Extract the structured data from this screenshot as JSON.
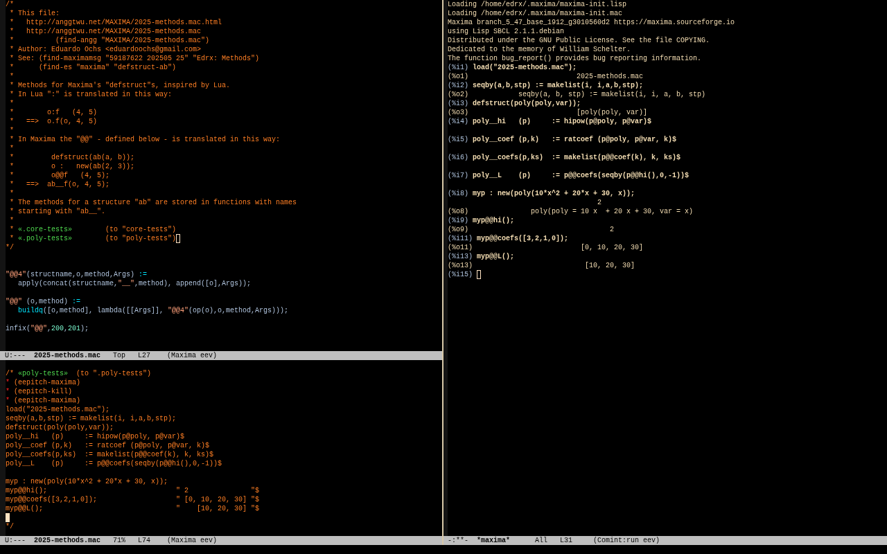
{
  "windows": [
    {
      "lines": [
        {
          "kind": "text",
          "segments": [
            {
              "text": "/*",
              "kind": "comment"
            }
          ]
        },
        {
          "kind": "text",
          "segments": [
            {
              "text": " * This file:",
              "kind": "comment"
            }
          ]
        },
        {
          "kind": "text",
          "segments": [
            {
              "text": " *   http://anggtwu.net/MAXIMA/2025-methods.mac.html",
              "kind": "comment"
            }
          ]
        },
        {
          "kind": "text",
          "segments": [
            {
              "text": " *   http://anggtwu.net/MAXIMA/2025-methods.mac",
              "kind": "comment"
            }
          ]
        },
        {
          "kind": "text",
          "segments": [
            {
              "text": " *          (find-angg \"MAXIMA/2025-methods.mac\")",
              "kind": "comment"
            }
          ]
        },
        {
          "kind": "text",
          "segments": [
            {
              "text": " * Author: Eduardo Ochs <eduardoochs@gmail.com>",
              "kind": "comment"
            }
          ]
        },
        {
          "kind": "text",
          "segments": [
            {
              "text": " * See: (find-maximamsg \"59187622 202505 25\" \"Edrx: Methods\")",
              "kind": "comment"
            }
          ]
        },
        {
          "kind": "text",
          "segments": [
            {
              "text": " *      (find-es \"maxima\" \"defstruct-ab\")",
              "kind": "comment"
            }
          ]
        },
        {
          "kind": "text",
          "segments": [
            {
              "text": " *",
              "kind": "comment"
            }
          ]
        },
        {
          "kind": "text",
          "segments": [
            {
              "text": " * Methods for Maxima's \"defstruct\"s, inspired by Lua.",
              "kind": "comment"
            }
          ]
        },
        {
          "kind": "text",
          "segments": [
            {
              "text": " * In Lua \":\" is translated in this way:",
              "kind": "comment"
            }
          ]
        },
        {
          "kind": "text",
          "segments": [
            {
              "text": " *",
              "kind": "comment"
            }
          ]
        },
        {
          "kind": "text",
          "segments": [
            {
              "text": " *        o:f   (4, 5)",
              "kind": "comment"
            }
          ]
        },
        {
          "kind": "text",
          "segments": [
            {
              "text": " *   ==>  o.f(o, 4, 5)",
              "kind": "comment"
            }
          ]
        },
        {
          "kind": "text",
          "segments": [
            {
              "text": " *",
              "kind": "comment"
            }
          ]
        },
        {
          "kind": "text",
          "segments": [
            {
              "text": " * In Maxima the \"@@\" - defined below - is translated in this way:",
              "kind": "comment"
            }
          ]
        },
        {
          "kind": "text",
          "segments": [
            {
              "text": " *",
              "kind": "comment"
            }
          ]
        },
        {
          "kind": "text",
          "segments": [
            {
              "text": " *         defstruct(ab(a, b));",
              "kind": "comment"
            }
          ]
        },
        {
          "kind": "text",
          "segments": [
            {
              "text": " *         o :   new(ab(2, 3));",
              "kind": "comment"
            }
          ]
        },
        {
          "kind": "text",
          "segments": [
            {
              "text": " *         o@@f   (4, 5);",
              "kind": "comment"
            }
          ]
        },
        {
          "kind": "text",
          "segments": [
            {
              "text": " *   ==>  ab__f(o, 4, 5);",
              "kind": "comment"
            }
          ]
        },
        {
          "kind": "text",
          "segments": [
            {
              "text": " *",
              "kind": "comment"
            }
          ]
        },
        {
          "kind": "text",
          "segments": [
            {
              "text": " * The methods for a structure \"ab\" are stored in functions with names",
              "kind": "comment"
            }
          ]
        },
        {
          "kind": "text",
          "segments": [
            {
              "text": " * starting with \"ab__\".",
              "kind": "comment"
            }
          ]
        },
        {
          "kind": "text",
          "segments": [
            {
              "text": " *",
              "kind": "comment"
            }
          ]
        },
        {
          "kind": "text",
          "segments": [
            {
              "text": " * ",
              "kind": "comment"
            },
            {
              "text": "«.core-tests»",
              "kind": "anchor"
            },
            {
              "text": "        (to \"core-tests\")",
              "kind": "comment"
            }
          ]
        },
        {
          "kind": "text",
          "segments": [
            {
              "text": " * ",
              "kind": "comment"
            },
            {
              "text": "«.poly-tests»",
              "kind": "anchor"
            },
            {
              "text": "        (to \"poly-tests\")",
              "kind": "comment"
            }
          ],
          "cursor": {
            "filled": false
          }
        },
        {
          "kind": "text",
          "segments": [
            {
              "text": "*/",
              "kind": "comment"
            }
          ]
        },
        {
          "kind": "blank"
        },
        {
          "kind": "blank"
        },
        {
          "kind": "text",
          "segments": [
            {
              "text": "\"@@4\"",
              "kind": "string"
            },
            {
              "text": "(structname,o,method,Args) ",
              "kind": "code"
            },
            {
              "text": ":=",
              "kind": "op"
            }
          ]
        },
        {
          "kind": "text",
          "segments": [
            {
              "text": "   apply(concat(structname,",
              "kind": "code"
            },
            {
              "text": "\"__\"",
              "kind": "string"
            },
            {
              "text": ",method), append([o],Args));",
              "kind": "code"
            }
          ]
        },
        {
          "kind": "blank"
        },
        {
          "kind": "text",
          "segments": [
            {
              "text": "\"@@\"",
              "kind": "string"
            },
            {
              "text": " (o,method) ",
              "kind": "code"
            },
            {
              "text": ":=",
              "kind": "op"
            }
          ]
        },
        {
          "kind": "text",
          "segments": [
            {
              "text": "   buildq",
              "kind": "op"
            },
            {
              "text": "([o,method], lambda([[Args]], ",
              "kind": "code"
            },
            {
              "text": "\"@@4\"",
              "kind": "string"
            },
            {
              "text": "(op(o),o,method,Args)));",
              "kind": "code"
            }
          ]
        },
        {
          "kind": "blank"
        },
        {
          "kind": "text",
          "segments": [
            {
              "text": "infix(",
              "kind": "code"
            },
            {
              "text": "\"@@\"",
              "kind": "string"
            },
            {
              "text": ",",
              "kind": "code"
            },
            {
              "text": "200",
              "kind": "number"
            },
            {
              "text": ",",
              "kind": "code"
            },
            {
              "text": "201",
              "kind": "number"
            },
            {
              "text": ");",
              "kind": "code"
            }
          ]
        }
      ],
      "mode_line": [
        {
          "text": "U:---  ",
          "bold": false
        },
        {
          "text": "2025-methods.mac",
          "bold": true
        },
        {
          "text": "   Top   L27    (Maxima eev)",
          "bold": false
        }
      ]
    },
    {
      "lines": [
        {
          "kind": "blank"
        },
        {
          "kind": "text",
          "segments": [
            {
              "text": "/* ",
              "kind": "comment"
            },
            {
              "text": "«poly-tests»",
              "kind": "anchor"
            },
            {
              "text": "  (to \".poly-tests\")",
              "kind": "comment"
            }
          ]
        },
        {
          "kind": "text",
          "segments": [
            {
              "text": "*",
              "kind": "star"
            },
            {
              "text": " (eepitch-maxima)",
              "kind": "comment"
            }
          ]
        },
        {
          "kind": "text",
          "segments": [
            {
              "text": "*",
              "kind": "star"
            },
            {
              "text": " (eepitch-kill)",
              "kind": "comment"
            }
          ]
        },
        {
          "kind": "text",
          "segments": [
            {
              "text": "*",
              "kind": "star"
            },
            {
              "text": " (eepitch-maxima)",
              "kind": "comment"
            }
          ]
        },
        {
          "kind": "text",
          "segments": [
            {
              "text": "load(\"2025-methods.mac\");",
              "kind": "comment"
            }
          ]
        },
        {
          "kind": "text",
          "segments": [
            {
              "text": "seqby(a,b,stp) := makelist(i, i,a,b,stp);",
              "kind": "comment"
            }
          ]
        },
        {
          "kind": "text",
          "segments": [
            {
              "text": "defstruct(poly(poly,var));",
              "kind": "comment"
            }
          ]
        },
        {
          "kind": "text",
          "segments": [
            {
              "text": "poly__hi   (p)     := hipow(p@poly, p@var)$",
              "kind": "comment"
            }
          ]
        },
        {
          "kind": "text",
          "segments": [
            {
              "text": "poly__coef (p,k)   := ratcoef (p@poly, p@var, k)$",
              "kind": "comment"
            }
          ]
        },
        {
          "kind": "text",
          "segments": [
            {
              "text": "poly__coefs(p,ks)  := makelist(p@@coef(k), k, ks)$",
              "kind": "comment"
            }
          ]
        },
        {
          "kind": "text",
          "segments": [
            {
              "text": "poly__L    (p)     := p@@coefs(seqby(p@@hi(),0,-1))$",
              "kind": "comment"
            }
          ]
        },
        {
          "kind": "blank"
        },
        {
          "kind": "text",
          "segments": [
            {
              "text": "myp : new(poly(10*x^2 + 20*x + 30, x));",
              "kind": "comment"
            }
          ]
        },
        {
          "kind": "text",
          "segments": [
            {
              "text": "myp@@hi();                               \" 2               \"$",
              "kind": "comment"
            }
          ]
        },
        {
          "kind": "text",
          "segments": [
            {
              "text": "myp@@coefs([3,2,1,0]);                   \" [0, 10, 20, 30] \"$",
              "kind": "comment"
            }
          ]
        },
        {
          "kind": "text",
          "segments": [
            {
              "text": "myp@@L();                                \"    [10, 20, 30] \"$",
              "kind": "comment"
            }
          ]
        },
        {
          "kind": "cursor",
          "cursor": {
            "filled": true
          }
        },
        {
          "kind": "text",
          "segments": [
            {
              "text": "*/",
              "kind": "comment"
            }
          ]
        }
      ],
      "mode_line": [
        {
          "text": "U:---  ",
          "bold": false
        },
        {
          "text": "2025-methods.mac",
          "bold": true
        },
        {
          "text": "   71%   L74    (Maxima eev)",
          "bold": false
        }
      ]
    },
    {
      "lines": [
        {
          "kind": "text",
          "segments": [
            {
              "text": "Loading /home/edrx/.maxima/maxima-init.lisp",
              "kind": "output"
            }
          ]
        },
        {
          "kind": "text",
          "segments": [
            {
              "text": "Loading /home/edrx/.maxima/maxima-init.mac",
              "kind": "output"
            }
          ]
        },
        {
          "kind": "text",
          "segments": [
            {
              "text": "Maxima branch_5_47_base_1912_g3010560d2 https://maxima.sourceforge.io",
              "kind": "output"
            }
          ]
        },
        {
          "kind": "text",
          "segments": [
            {
              "text": "using Lisp SBCL 2.1.1.debian",
              "kind": "output"
            }
          ]
        },
        {
          "kind": "text",
          "segments": [
            {
              "text": "Distributed under the GNU Public License. See the file COPYING.",
              "kind": "output"
            }
          ]
        },
        {
          "kind": "text",
          "segments": [
            {
              "text": "Dedicated to the memory of William Schelter.",
              "kind": "output"
            }
          ]
        },
        {
          "kind": "text",
          "segments": [
            {
              "text": "The function bug_report() provides bug reporting information.",
              "kind": "output"
            }
          ]
        },
        {
          "kind": "text",
          "segments": [
            {
              "text": "(%i1)",
              "kind": "prompt"
            },
            {
              "text": " load(\"2025-methods.mac\");",
              "kind": "input"
            }
          ]
        },
        {
          "kind": "text",
          "segments": [
            {
              "text": "(%o1)                          2025-methods.mac",
              "kind": "output"
            }
          ]
        },
        {
          "kind": "text",
          "segments": [
            {
              "text": "(%i2)",
              "kind": "prompt"
            },
            {
              "text": " seqby(a,b,stp) := makelist(i, i,a,b,stp);",
              "kind": "input"
            }
          ]
        },
        {
          "kind": "text",
          "segments": [
            {
              "text": "(%o2)            seqby(a, b, stp) := makelist(i, i, a, b, stp)",
              "kind": "output"
            }
          ]
        },
        {
          "kind": "text",
          "segments": [
            {
              "text": "(%i3)",
              "kind": "prompt"
            },
            {
              "text": " defstruct(poly(poly,var));",
              "kind": "input"
            }
          ]
        },
        {
          "kind": "text",
          "segments": [
            {
              "text": "(%o3)                          [poly(poly, var)]",
              "kind": "output"
            }
          ]
        },
        {
          "kind": "text",
          "segments": [
            {
              "text": "(%i4)",
              "kind": "prompt"
            },
            {
              "text": " poly__hi   (p)     := hipow(p@poly, p@var)$",
              "kind": "input"
            }
          ]
        },
        {
          "kind": "blank"
        },
        {
          "kind": "text",
          "segments": [
            {
              "text": "(%i5)",
              "kind": "prompt"
            },
            {
              "text": " poly__coef (p,k)   := ratcoef (p@poly, p@var, k)$",
              "kind": "input"
            }
          ]
        },
        {
          "kind": "blank"
        },
        {
          "kind": "text",
          "segments": [
            {
              "text": "(%i6)",
              "kind": "prompt"
            },
            {
              "text": " poly__coefs(p,ks)  := makelist(p@@coef(k), k, ks)$",
              "kind": "input"
            }
          ]
        },
        {
          "kind": "blank"
        },
        {
          "kind": "text",
          "segments": [
            {
              "text": "(%i7)",
              "kind": "prompt"
            },
            {
              "text": " poly__L    (p)     := p@@coefs(seqby(p@@hi(),0,-1))$",
              "kind": "input"
            }
          ]
        },
        {
          "kind": "blank"
        },
        {
          "kind": "text",
          "segments": [
            {
              "text": "(%i8)",
              "kind": "prompt"
            },
            {
              "text": " myp : new(poly(10*x^2 + 20*x + 30, x));",
              "kind": "input"
            }
          ]
        },
        {
          "kind": "text",
          "segments": [
            {
              "text": "                                    2",
              "kind": "output"
            }
          ]
        },
        {
          "kind": "text",
          "segments": [
            {
              "text": "(%o8)               poly(poly = 10 x  + 20 x + 30, var = x)",
              "kind": "output"
            }
          ]
        },
        {
          "kind": "text",
          "segments": [
            {
              "text": "(%i9)",
              "kind": "prompt"
            },
            {
              "text": " myp@@hi();",
              "kind": "input"
            }
          ]
        },
        {
          "kind": "text",
          "segments": [
            {
              "text": "(%o9)                                  2",
              "kind": "output"
            }
          ]
        },
        {
          "kind": "text",
          "segments": [
            {
              "text": "(%i11)",
              "kind": "prompt"
            },
            {
              "text": " myp@@coefs([3,2,1,0]);",
              "kind": "input"
            }
          ]
        },
        {
          "kind": "text",
          "segments": [
            {
              "text": "(%o11)                          [0, 10, 20, 30]",
              "kind": "output"
            }
          ]
        },
        {
          "kind": "text",
          "segments": [
            {
              "text": "(%i13)",
              "kind": "prompt"
            },
            {
              "text": " myp@@L();",
              "kind": "input"
            }
          ]
        },
        {
          "kind": "text",
          "segments": [
            {
              "text": "(%o13)                           [10, 20, 30]",
              "kind": "output"
            }
          ]
        },
        {
          "kind": "text",
          "segments": [
            {
              "text": "(%i15)",
              "kind": "prompt"
            }
          ],
          "cursor": {
            "filled": false
          }
        }
      ],
      "mode_line": [
        {
          "text": "-:**-  ",
          "bold": false
        },
        {
          "text": "*maxima*",
          "bold": true
        },
        {
          "text": "      All   L31     (Comint:run eev)",
          "bold": false
        }
      ]
    }
  ]
}
